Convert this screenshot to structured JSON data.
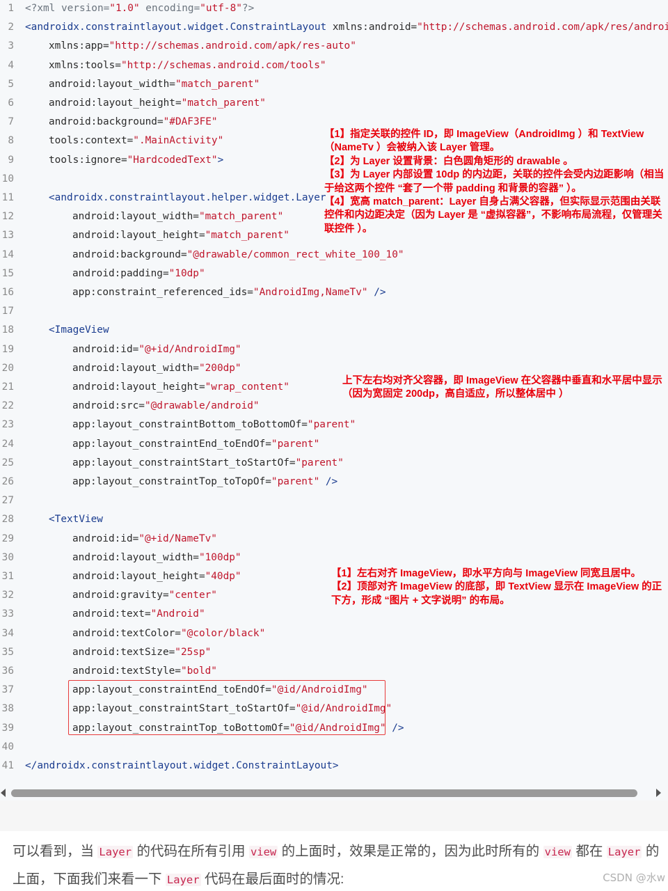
{
  "code": {
    "line_numbers": [
      "1",
      "2",
      "3",
      "4",
      "5",
      "6",
      "7",
      "8",
      "9",
      "10",
      "11",
      "12",
      "13",
      "14",
      "15",
      "16",
      "17",
      "18",
      "19",
      "20",
      "21",
      "22",
      "23",
      "24",
      "25",
      "26",
      "27",
      "28",
      "29",
      "30",
      "31",
      "32",
      "33",
      "34",
      "35",
      "36",
      "37",
      "38",
      "39",
      "40",
      "41"
    ],
    "l1": {
      "a": "<?xml version=",
      "b": "\"1.0\"",
      "c": " encoding=",
      "d": "\"utf-8\"",
      "e": "?>"
    },
    "l2": {
      "a": "<androidx.constraintlayout.widget.ConstraintLayout ",
      "b": "xmlns:android=",
      "c": "\"http://schemas.android.com/apk/res/android\""
    },
    "l3": {
      "a": "xmlns:app=",
      "b": "\"http://schemas.android.com/apk/res-auto\""
    },
    "l4": {
      "a": "xmlns:tools=",
      "b": "\"http://schemas.android.com/tools\""
    },
    "l5": {
      "a": "android:layout_width=",
      "b": "\"match_parent\""
    },
    "l6": {
      "a": "android:layout_height=",
      "b": "\"match_parent\""
    },
    "l7": {
      "a": "android:background=",
      "b": "\"#DAF3FE\""
    },
    "l8": {
      "a": "tools:context=",
      "b": "\".MainActivity\""
    },
    "l9": {
      "a": "tools:ignore=",
      "b": "\"HardcodedText\"",
      "c": ">"
    },
    "l11": {
      "a": "<androidx.constraintlayout.helper.widget.Layer"
    },
    "l12": {
      "a": "android:layout_width=",
      "b": "\"match_parent\""
    },
    "l13": {
      "a": "android:layout_height=",
      "b": "\"match_parent\""
    },
    "l14": {
      "a": "android:background=",
      "b": "\"@drawable/common_rect_white_100_10\""
    },
    "l15": {
      "a": "android:padding=",
      "b": "\"10dp\""
    },
    "l16": {
      "a": "app:constraint_referenced_ids=",
      "b": "\"AndroidImg,NameTv\"",
      "c": " />"
    },
    "l18": {
      "a": "<ImageView"
    },
    "l19": {
      "a": "android:id=",
      "b": "\"@+id/AndroidImg\""
    },
    "l20": {
      "a": "android:layout_width=",
      "b": "\"200dp\""
    },
    "l21": {
      "a": "android:layout_height=",
      "b": "\"wrap_content\""
    },
    "l22": {
      "a": "android:src=",
      "b": "\"@drawable/android\""
    },
    "l23": {
      "a": "app:layout_constraintBottom_toBottomOf=",
      "b": "\"parent\""
    },
    "l24": {
      "a": "app:layout_constraintEnd_toEndOf=",
      "b": "\"parent\""
    },
    "l25": {
      "a": "app:layout_constraintStart_toStartOf=",
      "b": "\"parent\""
    },
    "l26": {
      "a": "app:layout_constraintTop_toTopOf=",
      "b": "\"parent\"",
      "c": " />"
    },
    "l28": {
      "a": "<TextView"
    },
    "l29": {
      "a": "android:id=",
      "b": "\"@+id/NameTv\""
    },
    "l30": {
      "a": "android:layout_width=",
      "b": "\"100dp\""
    },
    "l31": {
      "a": "android:layout_height=",
      "b": "\"40dp\""
    },
    "l32": {
      "a": "android:gravity=",
      "b": "\"center\""
    },
    "l33": {
      "a": "android:text=",
      "b": "\"Android\""
    },
    "l34": {
      "a": "android:textColor=",
      "b": "\"@color/black\""
    },
    "l35": {
      "a": "android:textSize=",
      "b": "\"25sp\""
    },
    "l36": {
      "a": "android:textStyle=",
      "b": "\"bold\""
    },
    "l37": {
      "a": "app:layout_constraintEnd_toEndOf=",
      "b": "\"@id/AndroidImg\""
    },
    "l38": {
      "a": "app:layout_constraintStart_toStartOf=",
      "b": "\"@id/AndroidImg\""
    },
    "l39": {
      "a": "app:layout_constraintTop_toBottomOf=",
      "b": "\"@id/AndroidImg\"",
      "c": " />"
    },
    "l41": {
      "a": "</androidx.constraintlayout.widget.ConstraintLayout>"
    }
  },
  "notes": {
    "layer": [
      "【1】指定关联的控件 ID，即 ImageView（AndroidImg ）和 TextView（NameTv ）会被纳入该 Layer 管理。",
      "【2】为 Layer 设置背景：白色圆角矩形的 drawable 。",
      "【3】为 Layer 内部设置 10dp 的内边距，关联的控件会受内边距影响（相当于给这两个控件 “套了一个带 padding 和背景的容器” ）。",
      "【4】宽高 match_parent：Layer 自身占满父容器，但实际显示范围由关联控件和内边距决定（因为 Layer 是 “虚拟容器”，不影响布局流程，仅管理关联控件 ）。"
    ],
    "imageview": [
      "上下左右均对齐父容器，即 ImageView 在父容器中垂直和水平居中显示（因为宽固定 200dp，高自适应，所以整体居中 ）"
    ],
    "textview": [
      "【1】左右对齐 ImageView，即水平方向与 ImageView 同宽且居中。",
      "【2】顶部对齐 ImageView 的底部，即 TextView 显示在 ImageView 的正下方，形成 “图片 + 文字说明” 的布局。"
    ]
  },
  "paragraph": {
    "p1": "可以看到，当 ",
    "c1": "Layer",
    "p2": " 的代码在所有引用 ",
    "c2": "view",
    "p3": " 的上面时，效果是正常的，因为此时所有的 ",
    "c3": "view",
    "p4": " 都在 ",
    "c4": "Layer",
    "p5": " 的上面，下面我们来看一下 ",
    "c5": "Layer",
    "p6": " 代码在最后面时的情况:"
  },
  "watermark": "CSDN @水w"
}
